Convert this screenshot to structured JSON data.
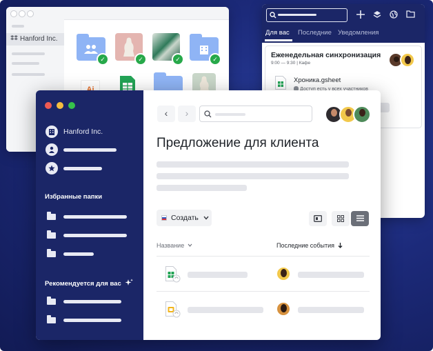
{
  "colors": {
    "navy": "#1b2667",
    "background": "#1c2a7a",
    "check_green": "#27a94a",
    "folder_blue": "#8fb4f5",
    "mac_red": "#ee5a52",
    "mac_yellow": "#f5bd3f",
    "mac_green": "#36c24a"
  },
  "back_window": {
    "org_name": "Hanford Inc.",
    "ai_label": "Ai",
    "icons": [
      "dropbox-icon",
      "people-folder-icon",
      "building-folder-icon",
      "check-icon",
      "spreadsheet-icon"
    ]
  },
  "right_window": {
    "tabs": [
      {
        "label": "Для вас"
      },
      {
        "label": "Последние"
      },
      {
        "label": "Уведомления"
      }
    ],
    "card": {
      "title": "Еженедельная синхронизация",
      "time": "9:00 — 9:30 | Кафе",
      "file_name": "Хроника.gsheet",
      "file_access": "Доступ есть у всех участников"
    },
    "toolbar_icons": [
      "plus-icon",
      "layers-icon",
      "globe-icon",
      "folder-icon"
    ]
  },
  "main_window": {
    "sidebar": {
      "org_name": "Hanford Inc.",
      "favorites_header": "Избранные папки",
      "recommended_header": "Рекомендуется для вас"
    },
    "page_title": "Предложение для клиента",
    "create_button": "Создать",
    "columns": {
      "name": "Название",
      "events": "Последние события"
    },
    "nav": {
      "back_glyph": "‹",
      "forward_glyph": "›"
    }
  }
}
